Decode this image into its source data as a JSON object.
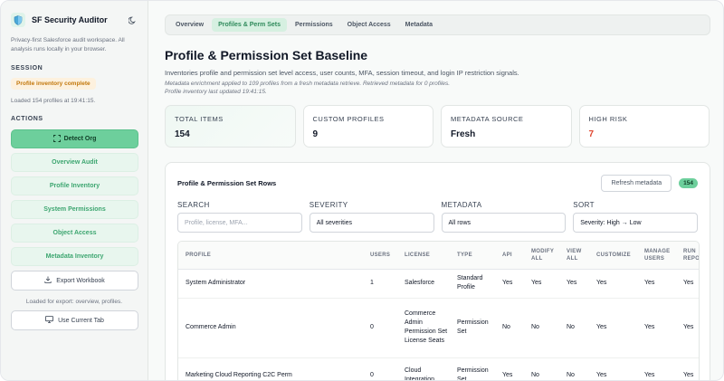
{
  "app": {
    "title": "SF Security Auditor",
    "tagline": "Privacy-first Salesforce audit workspace. All analysis runs locally in your browser."
  },
  "sidebar": {
    "session_label": "SESSION",
    "status_badge": "Profile inventory complete",
    "loaded_text": "Loaded 154 profiles at 19:41:15.",
    "actions_label": "ACTIONS",
    "detect_org": "Detect Org",
    "actions": [
      "Overview Audit",
      "Profile Inventory",
      "System Permissions",
      "Object Access",
      "Metadata Inventory"
    ],
    "export_workbook": "Export Workbook",
    "export_note": "Loaded for export: overview, profiles.",
    "use_current_tab": "Use Current Tab"
  },
  "tabs": [
    {
      "label": "Overview",
      "active": false
    },
    {
      "label": "Profiles & Perm Sets",
      "active": true
    },
    {
      "label": "Permissions",
      "active": false
    },
    {
      "label": "Object Access",
      "active": false
    },
    {
      "label": "Metadata",
      "active": false
    }
  ],
  "page": {
    "title": "Profile & Permission Set Baseline",
    "description": "Inventories profile and permission set level access, user counts, MFA, session timeout, and login IP restriction signals.",
    "note1": "Metadata enrichment applied to 109 profiles from a fresh metadata retrieve. Retrieved metadata for 0 profiles.",
    "note2": "Profile inventory last updated 19:41:15."
  },
  "cards": [
    {
      "label": "TOTAL ITEMS",
      "value": "154"
    },
    {
      "label": "CUSTOM PROFILES",
      "value": "9"
    },
    {
      "label": "METADATA SOURCE",
      "value": "Fresh"
    },
    {
      "label": "HIGH RISK",
      "value": "7"
    }
  ],
  "panel": {
    "title": "Profile & Permission Set Rows",
    "refresh": "Refresh metadata",
    "count": "154"
  },
  "filters": {
    "search_label": "SEARCH",
    "search_placeholder": "Profile, license, MFA...",
    "severity_label": "SEVERITY",
    "severity_value": "All severities",
    "metadata_label": "METADATA",
    "metadata_value": "All rows",
    "sort_label": "SORT",
    "sort_value": "Severity: High → Low"
  },
  "table": {
    "headers": [
      "PROFILE",
      "USERS",
      "LICENSE",
      "TYPE",
      "API",
      "MODIFY ALL",
      "VIEW ALL",
      "CUSTOMIZE",
      "MANAGE USERS",
      "RUN REPO"
    ],
    "rows": [
      [
        "System Administrator",
        "1",
        "Salesforce",
        "Standard Profile",
        "Yes",
        "Yes",
        "Yes",
        "Yes",
        "Yes",
        "Yes"
      ],
      [
        "Commerce Admin",
        "0",
        "Commerce Admin Permission Set License Seats",
        "Permission Set",
        "No",
        "No",
        "No",
        "Yes",
        "Yes",
        "Yes"
      ],
      [
        "Marketing Cloud Reporting C2C Perm",
        "0",
        "Cloud Integration",
        "Permission Set",
        "Yes",
        "No",
        "No",
        "Yes",
        "Yes",
        "Yes"
      ]
    ]
  },
  "colors": {
    "accent": "#6dcf9c",
    "accent_soft": "#e8f6ee",
    "warning_bg": "#fdf1de",
    "danger": "#e0462f"
  }
}
